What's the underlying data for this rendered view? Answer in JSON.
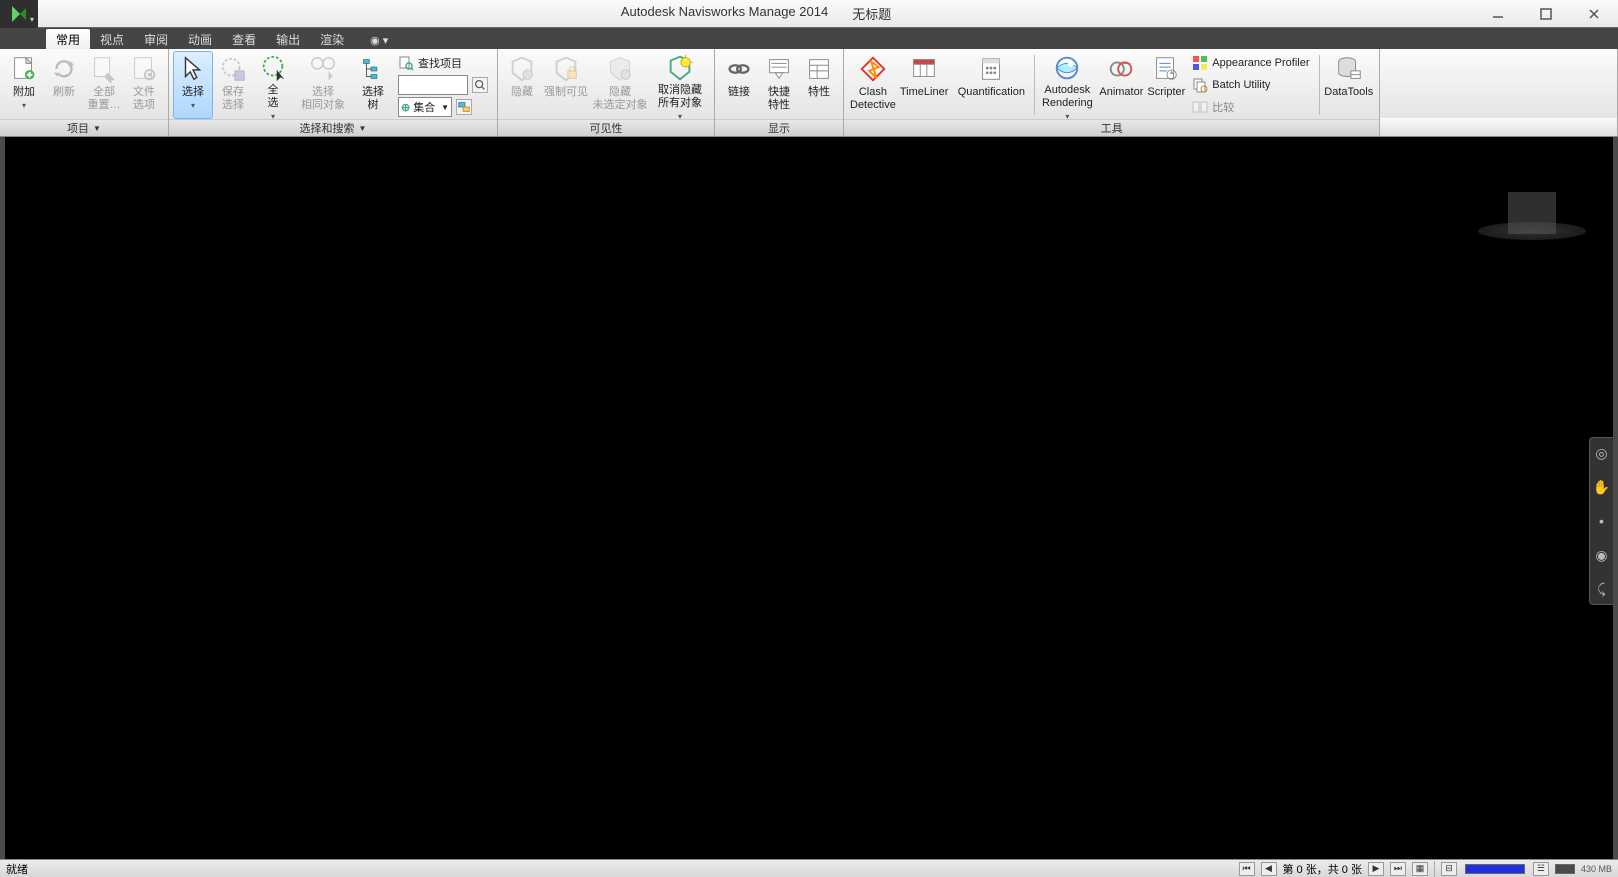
{
  "title": {
    "app": "Autodesk Navisworks Manage 2014",
    "doc": "无标题"
  },
  "tabs": {
    "items": [
      "常用",
      "视点",
      "审阅",
      "动画",
      "查看",
      "输出",
      "渲染"
    ],
    "active_index": 0,
    "help_indicator": "◉ ▾"
  },
  "ribbon": {
    "panels": {
      "project": {
        "label": "项目",
        "buttons": {
          "append": "附加",
          "refresh": "刷新",
          "reset_all": "全部\n重置…",
          "file_options": "文件\n选项"
        }
      },
      "select_search": {
        "label": "选择和搜索",
        "buttons": {
          "select": "选择",
          "save_sel": "保存\n选择",
          "select_all": "全\n选",
          "select_same": "选择\n相同对象",
          "sel_tree": "选择\n树",
          "find_items": "查找项目",
          "quick_find_placeholder": "",
          "sets_prefix": "⊕",
          "sets_label": "集合"
        }
      },
      "visibility": {
        "label": "可见性",
        "buttons": {
          "hide": "隐藏",
          "require": "强制可见",
          "hide_unsel": "隐藏\n未选定对象",
          "unhide_all": "取消隐藏\n所有对象"
        }
      },
      "display": {
        "label": "显示",
        "buttons": {
          "links": "链接",
          "quick_props": "快捷\n特性",
          "props": "特性"
        }
      },
      "tools": {
        "label": "工具",
        "buttons": {
          "clash": "Clash\nDetective",
          "timeliner": "TimeLiner",
          "quant": "Quantification",
          "rendering": "Autodesk\nRendering",
          "animator": "Animator",
          "scripter": "Scripter",
          "appearance": "Appearance Profiler",
          "batch": "Batch Utility",
          "compare": "比较",
          "datatools": "DataTools"
        }
      }
    }
  },
  "status": {
    "ready": "就绪",
    "sheets": "第 0 张，共 0 张",
    "zoom": "430   MB"
  },
  "icons": {
    "append": "append-icon",
    "refresh": "refresh-icon",
    "reset": "reset-icon",
    "fileopts": "file-options-icon",
    "cursor": "cursor-icon",
    "save-sel": "save-selection-icon",
    "select-all": "select-all-icon",
    "select-same": "select-same-icon",
    "tree": "tree-icon",
    "find": "find-icon",
    "search": "search-small-icon",
    "sets": "sets-icon",
    "hide": "hide-icon",
    "require": "require-icon",
    "hide-unsel": "hide-unselected-icon",
    "unhide": "unhide-all-icon",
    "links": "links-icon",
    "qprops": "quick-properties-icon",
    "props": "properties-icon",
    "clash": "clash-icon",
    "timeliner": "timeliner-icon",
    "quant": "quantification-icon",
    "rendering": "rendering-icon",
    "animator": "animator-icon",
    "scripter": "scripter-icon",
    "appearance": "appearance-icon",
    "batch": "batch-icon",
    "compare": "compare-icon",
    "datatools": "datatools-icon"
  }
}
